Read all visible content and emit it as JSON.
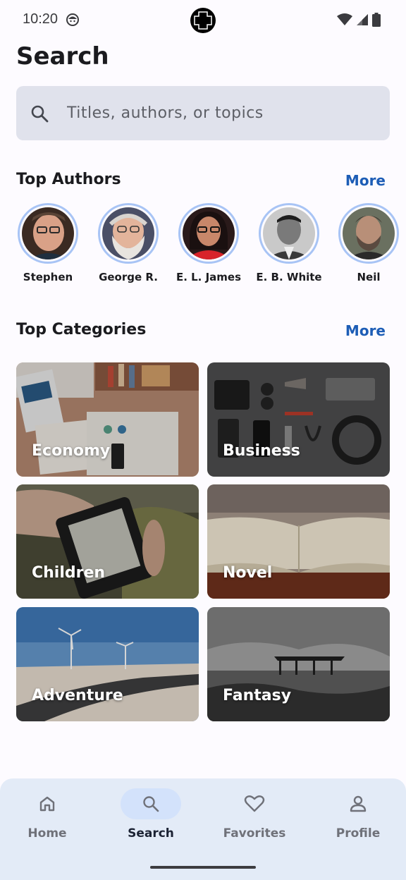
{
  "status_bar": {
    "time": "10:20"
  },
  "header": {
    "title": "Search"
  },
  "search": {
    "placeholder": "Titles, authors, or topics"
  },
  "top_authors": {
    "title": "Top Authors",
    "more_label": "More",
    "authors": [
      {
        "name": "Stephen"
      },
      {
        "name": "George R."
      },
      {
        "name": "E. L. James"
      },
      {
        "name": "E. B. White"
      },
      {
        "name": "Neil"
      }
    ]
  },
  "top_categories": {
    "title": "Top Categories",
    "more_label": "More",
    "categories": [
      {
        "label": "Economy"
      },
      {
        "label": "Business"
      },
      {
        "label": "Children"
      },
      {
        "label": "Novel"
      },
      {
        "label": "Adventure"
      },
      {
        "label": "Fantasy"
      }
    ]
  },
  "bottom_nav": {
    "items": [
      {
        "label": "Home",
        "icon": "home-icon"
      },
      {
        "label": "Search",
        "icon": "search-icon",
        "active": true
      },
      {
        "label": "Favorites",
        "icon": "heart-icon"
      },
      {
        "label": "Profile",
        "icon": "person-icon"
      }
    ]
  },
  "colors": {
    "accent": "#1d5db6",
    "search_bg": "#e0e2ec",
    "nav_bg": "#e3ebf7",
    "avatar_ring": "#a8c4f5"
  }
}
